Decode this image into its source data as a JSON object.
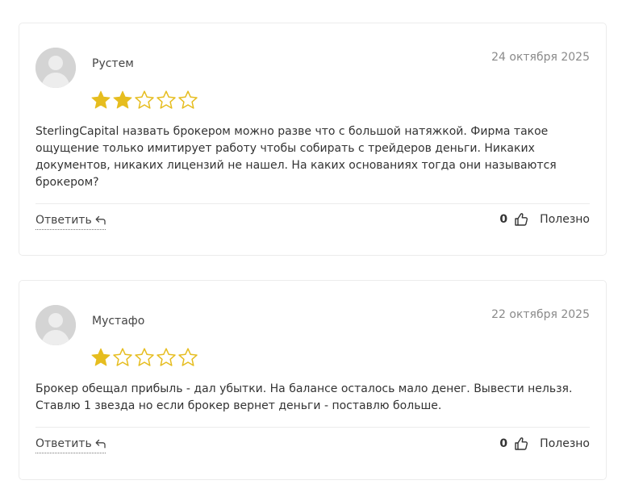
{
  "colors": {
    "star_filled": "#e6bd1f",
    "star_empty_stroke": "#e6bd1f",
    "card_border": "#ececec",
    "date_text": "#8a8a8a"
  },
  "reviews": [
    {
      "author": "Рустем",
      "date": "24 октября 2025",
      "rating": 2,
      "rating_max": 5,
      "text": "SterlingCapital назвать брокером можно разве что с большой натяжкой. Фирма такое ощущение только имитирует работу чтобы собирать с трейдеров деньги. Никаких документов, никаких лицензий не нашел. На каких основаниях тогда они называются брокером?",
      "reply_label": "Ответить",
      "likes": "0",
      "helpful_label": "Полезно",
      "avatar_icon": "user-avatar-placeholder"
    },
    {
      "author": "Мустафо",
      "date": "22 октября 2025",
      "rating": 1,
      "rating_max": 5,
      "text": "Брокер обещал прибыль - дал убытки. На балансе осталось мало денег. Вывести нельзя. Ставлю 1 звезда но если брокер вернет деньги - поставлю больше.",
      "reply_label": "Ответить",
      "likes": "0",
      "helpful_label": "Полезно",
      "avatar_icon": "user-avatar-placeholder"
    }
  ]
}
